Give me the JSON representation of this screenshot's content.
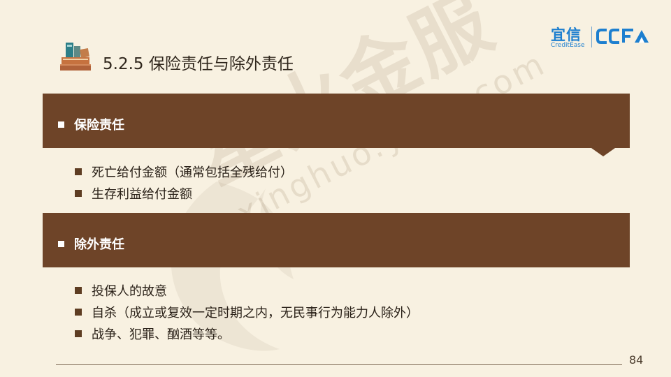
{
  "watermark": {
    "text": "星火金服",
    "url": "xinghuo.yixin.com"
  },
  "logo": {
    "cn": "宜信",
    "en": "CreditEase",
    "mark": "CCFA"
  },
  "slide": {
    "title": "5.2.5 保险责任与除外责任"
  },
  "sections": [
    {
      "heading": "保险责任",
      "items": [
        "死亡给付金额（通常包括全残给付）",
        "生存利益给付金额"
      ]
    },
    {
      "heading": "除外责任",
      "items": [
        "投保人的故意",
        "自杀（成立或复效一定时期之内，无民事行为能力人除外）",
        "战争、犯罪、酗酒等等。"
      ]
    }
  ],
  "footer": {
    "page_number": "84"
  },
  "colors": {
    "band": "#6e4428",
    "background": "#f8f1e1",
    "logo_blue": "#1d7fcf",
    "bullet": "#5e3d22"
  },
  "icons": {
    "title": "stacked-books-icon"
  }
}
